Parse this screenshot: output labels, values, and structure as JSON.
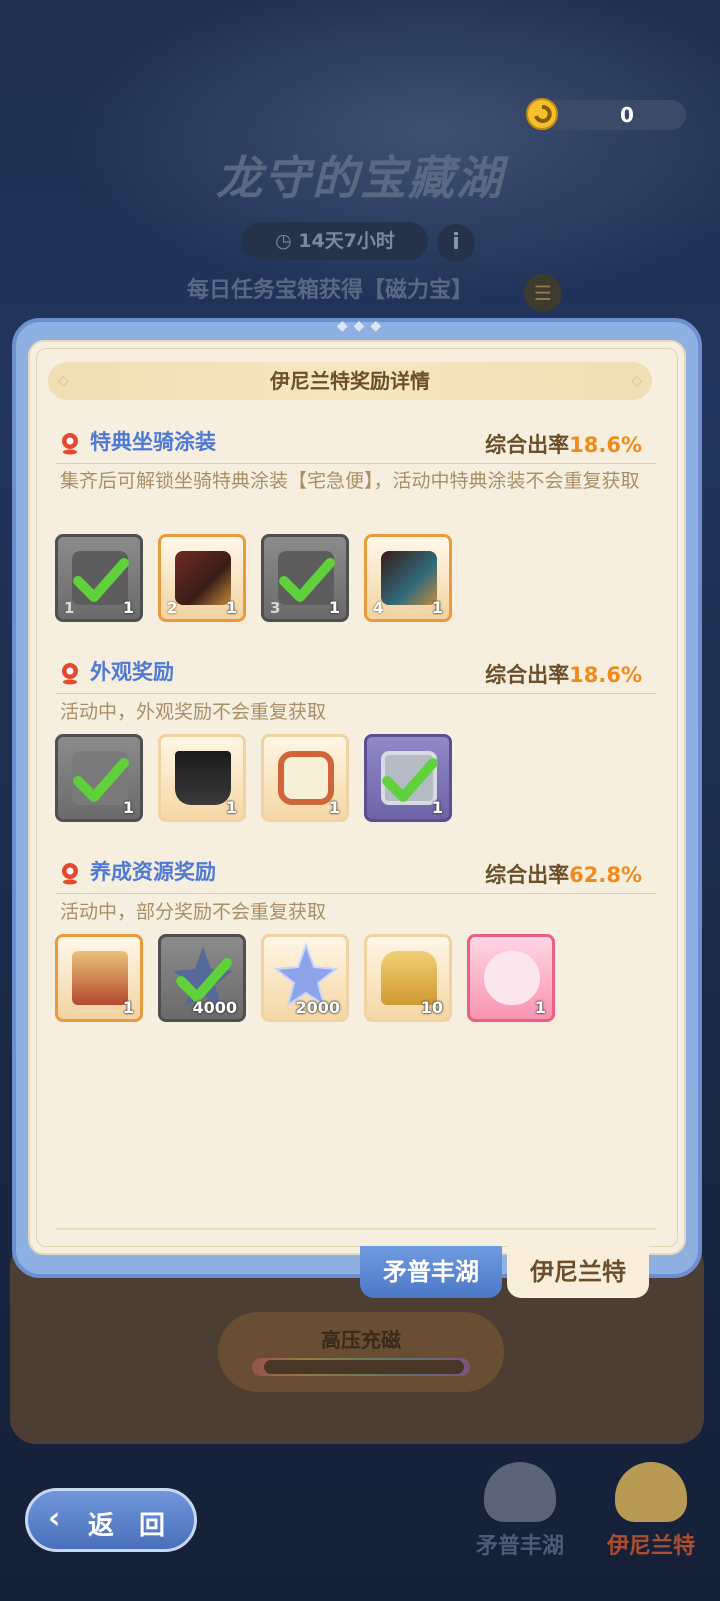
{
  "background": {
    "currency_value": "0",
    "event_title": "龙守的宝藏湖",
    "timer": "14天7小时",
    "daily_task_text": "每日任务宝箱获得【磁力宝】",
    "charge_label": "高压充磁",
    "back_label": "返 回",
    "bottom_tabs": [
      "矛普丰湖",
      "伊尼兰特"
    ]
  },
  "modal": {
    "title": "伊尼兰特奖励详情",
    "sections": [
      {
        "title": "特典坐骑涂装",
        "rate_label": "综合出率",
        "rate_value": "18.6%",
        "desc": "集齐后可解锁坐骑特典涂装【宅急便】，活动中特典涂装不会重复获取",
        "items": [
          {
            "index": "1",
            "qty": "1",
            "owned": true
          },
          {
            "index": "2",
            "qty": "1",
            "owned": false
          },
          {
            "index": "3",
            "qty": "1",
            "owned": true
          },
          {
            "index": "4",
            "qty": "1",
            "owned": false
          }
        ]
      },
      {
        "title": "外观奖励",
        "rate_label": "综合出率",
        "rate_value": "18.6%",
        "desc": "活动中，外观奖励不会重复获取",
        "items": [
          {
            "qty": "1",
            "owned": true
          },
          {
            "qty": "1",
            "owned": false
          },
          {
            "qty": "1",
            "owned": false
          },
          {
            "qty": "1",
            "owned": true
          }
        ]
      },
      {
        "title": "养成资源奖励",
        "rate_label": "综合出率",
        "rate_value": "62.8%",
        "desc": "活动中，部分奖励不会重复获取",
        "items": [
          {
            "qty": "1",
            "owned": false
          },
          {
            "qty": "4000",
            "owned": true
          },
          {
            "qty": "2000",
            "owned": false
          },
          {
            "qty": "10",
            "owned": false
          },
          {
            "qty": "1",
            "owned": false
          }
        ]
      }
    ],
    "tabs": [
      "矛普丰湖",
      "伊尼兰特"
    ],
    "active_tab": "矛普丰湖"
  },
  "colors": {
    "accent_blue": "#4e7ad6",
    "rate_orange": "#f08a1a",
    "panel_bg": "#f6efe0"
  }
}
